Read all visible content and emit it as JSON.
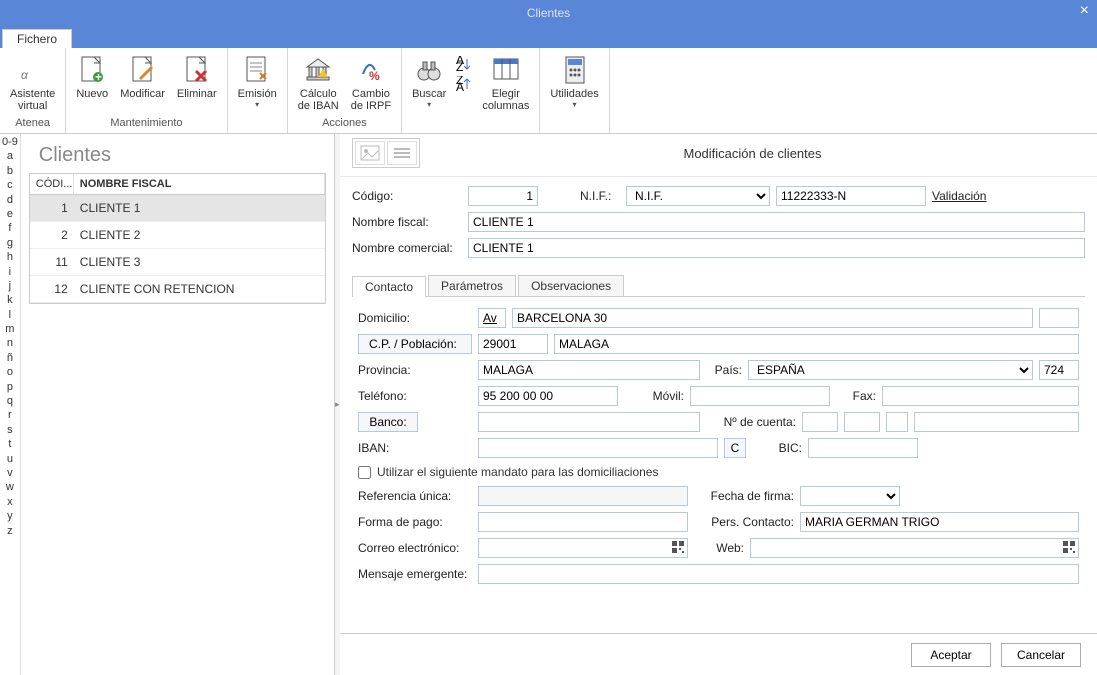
{
  "window": {
    "title": "Clientes"
  },
  "tabs": {
    "file": "Fichero"
  },
  "ribbon": {
    "atenea": {
      "label": "Atenea",
      "assist": "Asistente\nvirtual"
    },
    "mant": {
      "label": "Mantenimiento",
      "nuevo": "Nuevo",
      "modificar": "Modificar",
      "eliminar": "Eliminar"
    },
    "emision": "Emisión",
    "acciones": {
      "label": "Acciones",
      "iban": "Cálculo\nde IBAN",
      "irpf": "Cambio\nde IRPF"
    },
    "buscar": "Buscar",
    "cols": "Elegir\ncolumnas",
    "util": "Utilidades"
  },
  "alpha": [
    "0-9",
    "a",
    "b",
    "c",
    "d",
    "e",
    "f",
    "g",
    "h",
    "i",
    "j",
    "k",
    "l",
    "m",
    "n",
    "ñ",
    "o",
    "p",
    "q",
    "r",
    "s",
    "t",
    "u",
    "v",
    "w",
    "x",
    "y",
    "z"
  ],
  "list": {
    "heading": "Clientes",
    "cols": {
      "codi": "CÓDI...",
      "name": "NOMBRE FISCAL"
    },
    "rows": [
      {
        "id": "1",
        "name": "CLIENTE 1",
        "selected": true
      },
      {
        "id": "2",
        "name": "CLIENTE 2"
      },
      {
        "id": "11",
        "name": "CLIENTE 3"
      },
      {
        "id": "12",
        "name": "CLIENTE CON RETENCION"
      }
    ]
  },
  "detail": {
    "title": "Modificación de clientes",
    "labels": {
      "codigo": "Código:",
      "nif": "N.I.F.:",
      "validacion": "Validación",
      "nombre_fiscal": "Nombre fiscal:",
      "nombre_com": "Nombre comercial:"
    },
    "codigo": "1",
    "nif_type": "N.I.F.",
    "nif": "11222333-N",
    "nombre_fiscal": "CLIENTE 1",
    "nombre_com": "CLIENTE 1",
    "tabs": {
      "contacto": "Contacto",
      "parametros": "Parámetros",
      "obs": "Observaciones"
    },
    "contacto": {
      "labels": {
        "domicilio": "Domicilio:",
        "cp": "C.P. / Población:",
        "provincia": "Provincia:",
        "pais": "País:",
        "telefono": "Teléfono:",
        "movil": "Móvil:",
        "fax": "Fax:",
        "banco": "Banco:",
        "cuenta": "Nº de cuenta:",
        "iban": "IBAN:",
        "bic": "BIC:",
        "mandato": "Utilizar el siguiente mandato para las domiciliaciones",
        "ref": "Referencia única:",
        "firma": "Fecha de firma:",
        "pago": "Forma de pago:",
        "contacto": "Pers. Contacto:",
        "correo": "Correo electrónico:",
        "web": "Web:",
        "mensaje": "Mensaje emergente:"
      },
      "dom_tipo": "Av",
      "dom": "BARCELONA 30",
      "cp": "29001",
      "poblacion": "MALAGA",
      "provincia": "MALAGA",
      "pais": "ESPAÑA",
      "pais_code": "724",
      "telefono": "95 200 00 00",
      "movil": "",
      "fax": "",
      "iban_calc": "C",
      "contacto": "MARIA GERMAN TRIGO"
    }
  },
  "footer": {
    "aceptar": "Aceptar",
    "cancelar": "Cancelar"
  }
}
